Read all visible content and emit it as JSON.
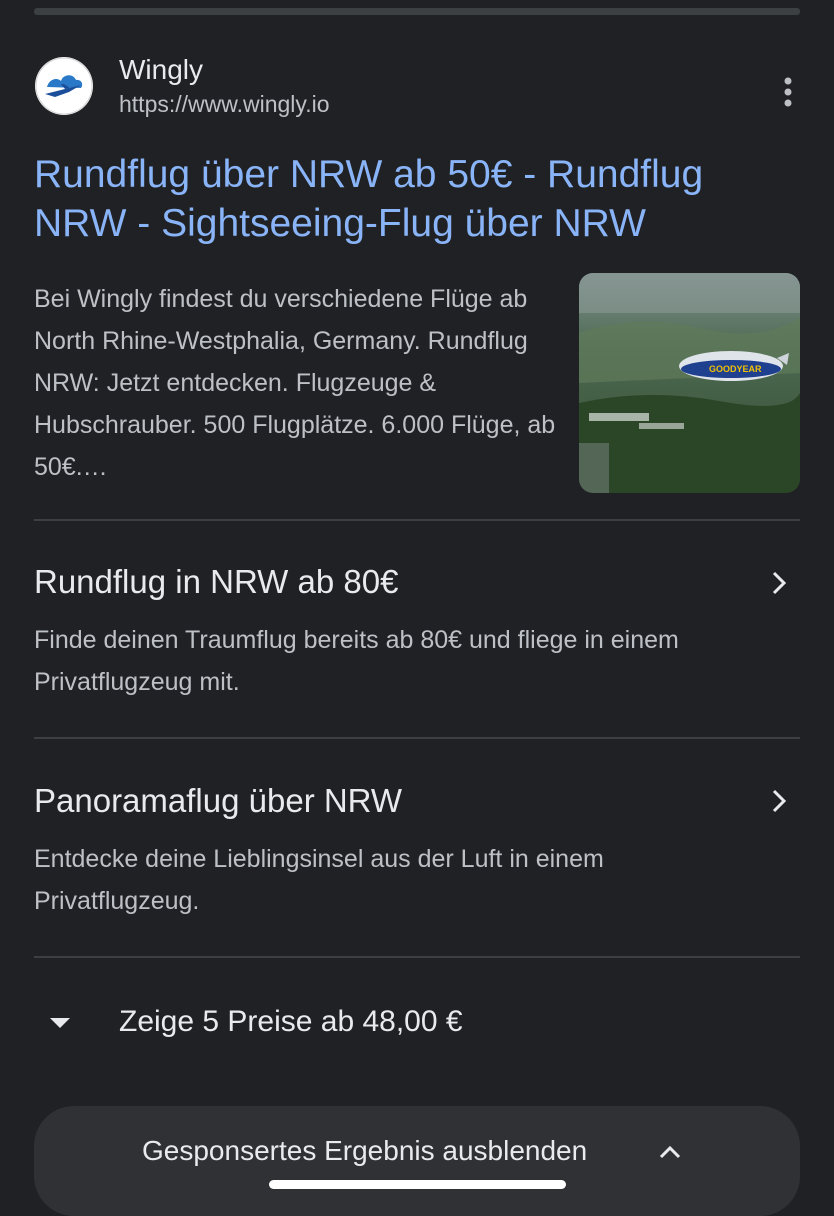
{
  "site": {
    "name": "Wingly",
    "url": "https://www.wingly.io"
  },
  "result": {
    "title": "Rundflug über NRW ab 50€ - Rundflug NRW - Sightseeing-Flug über NRW",
    "snippet": "Bei Wingly findest du verschiedene Flüge ab North Rhine-Westphalia, Germany. Rundflug NRW: Jetzt entdecken. Flugzeuge & Hubschrauber. 500 Flugplätze. 6.000 Flüge, ab 50€.…",
    "thumbnail_text": "GOODYEAR"
  },
  "sitelinks": [
    {
      "title": "Rundflug in NRW ab 80€",
      "description": "Finde deinen Traumflug bereits ab 80€ und fliege in einem Privatflugzeug mit."
    },
    {
      "title": "Panoramaflug über NRW",
      "description": "Entdecke deine Lieblingsinsel aus der Luft in einem Privatflugzeug."
    }
  ],
  "prices": {
    "label": "Zeige 5 Preise ab 48,00 €"
  },
  "hide_bar": {
    "label": "Gesponsertes Ergebnis ausblenden"
  },
  "colors": {
    "background": "#202124",
    "link": "#8ab4f8",
    "text": "#e8eaed",
    "muted": "#bdc1c6"
  },
  "icons": {
    "logo": "wingly-logo",
    "more": "more-vert-icon",
    "chevron_right": "chevron-right-icon",
    "caret_down": "caret-down-icon",
    "chevron_up": "chevron-up-icon"
  }
}
